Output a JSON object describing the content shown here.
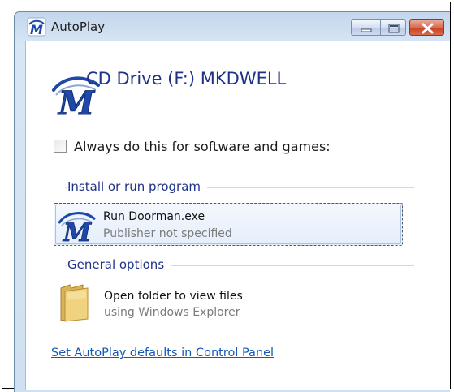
{
  "window": {
    "title": "AutoPlay",
    "app_icon": "mkdwell-m-logo-icon",
    "buttons": {
      "minimize_icon": "minimize-icon",
      "maximize_icon": "maximize-icon",
      "close_icon": "close-icon"
    }
  },
  "drive": {
    "title": "CD Drive (F:) MKDWELL",
    "icon": "mkdwell-m-logo-icon"
  },
  "always_checkbox": {
    "label": "Always do this for software and games:",
    "checked": false
  },
  "groups": [
    {
      "label": "Install or run program",
      "options": [
        {
          "title": "Run Doorman.exe",
          "subtitle": "Publisher not specified",
          "icon": "mkdwell-m-logo-icon",
          "selected": true
        }
      ]
    },
    {
      "label": "General options",
      "options": [
        {
          "title": "Open folder to view files",
          "subtitle": "using Windows Explorer",
          "icon": "folder-icon",
          "selected": false
        }
      ]
    }
  ],
  "footer_link": "Set AutoPlay defaults in Control Panel",
  "colors": {
    "accent_text": "#1e3287",
    "link": "#1458b8",
    "logo_blue": "#1e49a8",
    "title_bar": "#c3d6ec",
    "close_button": "#c84120"
  }
}
